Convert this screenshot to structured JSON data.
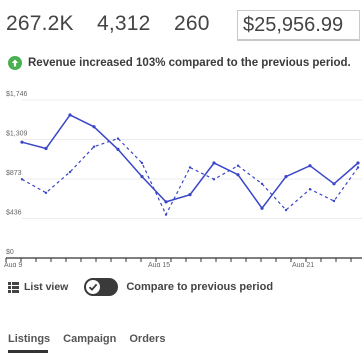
{
  "stats": {
    "revenue_short": "267.2K",
    "count_a": "4,312",
    "count_b": "260",
    "amount_input": "$25,956.99"
  },
  "notice": {
    "text": "Revenue increased 103% compared to the previous period.",
    "icon": "arrow-up-circle-icon",
    "color": "#4caf50"
  },
  "chart_data": {
    "type": "line",
    "y_ticks": [
      "$1,746",
      "$1,309",
      "$873",
      "$436",
      "$0"
    ],
    "x_ticks": [
      "Aug 9",
      "Aug 15",
      "Aug 21"
    ],
    "ylim": [
      0,
      1746
    ],
    "x": [
      9,
      10,
      11,
      12,
      13,
      14,
      15,
      16,
      17,
      18,
      19,
      20,
      21,
      22,
      23
    ],
    "series": [
      {
        "values": [
          1280,
          1210,
          1580,
          1450,
          1200,
          900,
          620,
          700,
          1050,
          920,
          550,
          900,
          1020,
          820,
          1050
        ],
        "color": "#3a46c8",
        "style": "solid"
      },
      {
        "values": [
          870,
          720,
          950,
          1230,
          1320,
          1050,
          480,
          1000,
          870,
          1020,
          820,
          530,
          760,
          630,
          1000
        ],
        "color": "#3a46c8",
        "style": "dashed"
      }
    ],
    "grid": true
  },
  "controls": {
    "list_view_label": "List view",
    "list_view_icon": "grid-list-icon",
    "compare_label": "Compare to previous period",
    "compare_enabled": true
  },
  "tabs": {
    "items": [
      "Listings",
      "Campaign",
      "Orders"
    ],
    "active": "Listings"
  }
}
